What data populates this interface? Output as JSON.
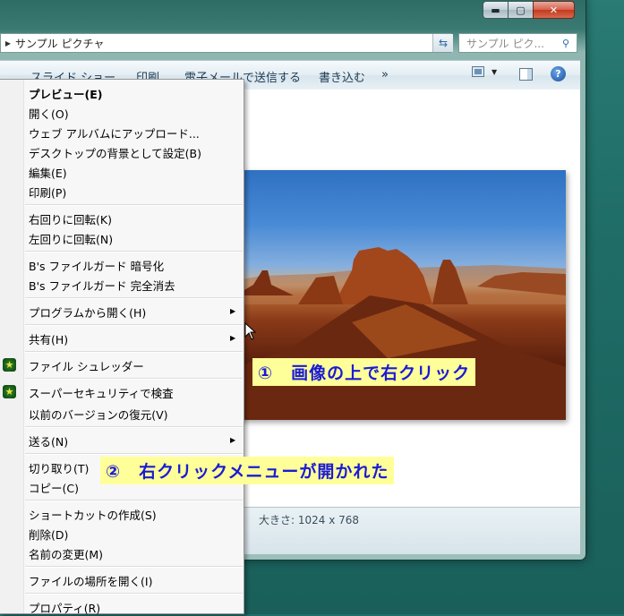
{
  "window": {
    "address_path": "サンプル ピクチャ",
    "search_placeholder": "サンプル ピク...",
    "caption_buttons": {
      "minimize": "▬",
      "maximize": "▢",
      "close": "✕"
    }
  },
  "toolbar": {
    "items": [
      "スライド ショー",
      "印刷",
      "電子メールで送信する",
      "書き込む",
      "»"
    ]
  },
  "status": {
    "size_text": "大きさ: 1024 x 768"
  },
  "context_menu": {
    "items": [
      "プレビュー(E)",
      "開く(O)",
      "ウェブ アルバムにアップロード...",
      "デスクトップの背景として設定(B)",
      "編集(E)",
      "印刷(P)",
      "右回りに回転(K)",
      "左回りに回転(N)",
      "B's ファイルガード 暗号化",
      "B's ファイルガード 完全消去",
      "プログラムから開く(H)",
      "共有(H)",
      "ファイル シュレッダー",
      "スーパーセキュリティで検査",
      "以前のバージョンの復元(V)",
      "送る(N)",
      "切り取り(T)",
      "コピー(C)",
      "ショートカットの作成(S)",
      "削除(D)",
      "名前の変更(M)",
      "ファイルの場所を開く(I)",
      "プロパティ(R)"
    ]
  },
  "annotations": {
    "step1": "①　画像の上で右クリック",
    "step2": "②　右クリックメニューが開かれた"
  },
  "colors": {
    "callout_bg": "#ffff99",
    "callout_text": "#1a1ad6",
    "desktop": "#1e6f6a"
  }
}
